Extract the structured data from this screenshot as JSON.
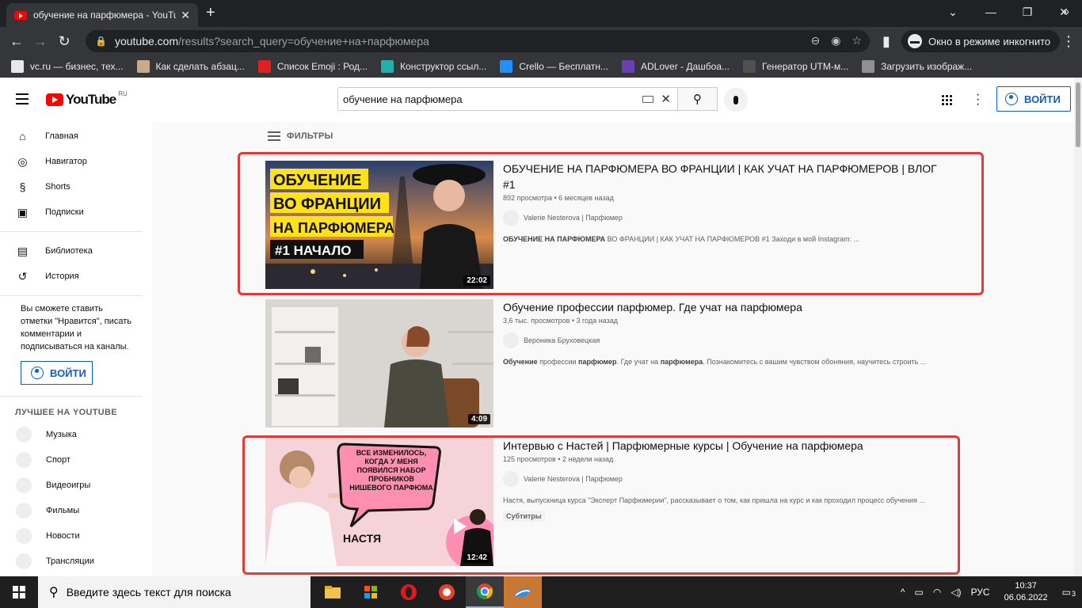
{
  "browser": {
    "tab_title": "обучение на парфюмера - YouTube",
    "url_host": "youtube.com",
    "url_path": "/results?search_query=обучение+на+парфюмера",
    "incognito_label": "Окно в режиме инкогнито",
    "bookmarks": [
      {
        "label": "vc.ru — бизнес, тех...",
        "color": "#e8e8e8"
      },
      {
        "label": "Как сделать абзац...",
        "color": "#c9a98b"
      },
      {
        "label": "Список Emoji : Род...",
        "color": "#e02020"
      },
      {
        "label": "Конструктор ссыл...",
        "color": "#20b2aa"
      },
      {
        "label": "Crello — Бесплатн...",
        "color": "#1e90ff"
      },
      {
        "label": "ADLover - Дашбоа...",
        "color": "#6a3fb5"
      },
      {
        "label": "Генератор UTM-м...",
        "color": "#505050"
      },
      {
        "label": "Загрузить изображ...",
        "color": "#909090"
      }
    ]
  },
  "youtube": {
    "logo_text": "YouTube",
    "logo_region": "RU",
    "search_value": "обучение на парфюмера",
    "signin_label": "ВОЙТИ",
    "filters_label": "ФИЛЬТРЫ",
    "sidebar": {
      "main": [
        {
          "label": "Главная",
          "icon": "home-icon",
          "glyph": "⌂"
        },
        {
          "label": "Навигатор",
          "icon": "compass-icon",
          "glyph": "◎"
        },
        {
          "label": "Shorts",
          "icon": "shorts-icon",
          "glyph": "§"
        },
        {
          "label": "Подписки",
          "icon": "subscriptions-icon",
          "glyph": "▣"
        }
      ],
      "library": [
        {
          "label": "Библиотека",
          "icon": "library-icon",
          "glyph": "▤"
        },
        {
          "label": "История",
          "icon": "history-icon",
          "glyph": "↺"
        }
      ],
      "signin_prompt": "Вы сможете ставить отметки \"Нравится\", писать комментарии и подписываться на каналы.",
      "signin_label": "ВОЙТИ",
      "best_header": "ЛУЧШЕЕ НА YOUTUBE",
      "best": [
        "Музыка",
        "Спорт",
        "Видеоигры",
        "Фильмы",
        "Новости",
        "Трансляции"
      ]
    },
    "results": [
      {
        "title": "ОБУЧЕНИЕ НА ПАРФЮМЕРА ВО ФРАНЦИИ | КАК УЧАТ НА ПАРФЮМЕРОВ | ВЛОГ #1",
        "meta": "892 просмотра • 6 месяцев назад",
        "channel": "Valerie Nesterova | Парфюмер",
        "desc_bold": "ОБУЧЕНИЕ НА ПАРФЮМЕРА",
        "desc_rest": " ВО ФРАНЦИИ | КАК УЧАТ НА ПАРФЮМЕРОВ #1 Заходи в мой Instagram: ...",
        "duration": "22:02",
        "thumb_lines": [
          "ОБУЧЕНИЕ",
          "ВО ФРАНЦИИ",
          "НА ПАРФЮМЕРА",
          "#1 НАЧАЛО"
        ]
      },
      {
        "title": "Обучение профессии парфюмер. Где учат на парфюмера",
        "meta": "3,6 тыс. просмотров • 3 года назад",
        "channel": "Вероника Бруховецкая",
        "desc_html_parts": [
          "Обучение",
          " профессии ",
          "парфюмер",
          ". Где учат на ",
          "парфюмера",
          ". Познакомитесь с вашим чувством обоняния, научитесь строить ..."
        ],
        "duration": "4:09"
      },
      {
        "title": "Интервью с Настей | Парфюмерные курсы | Обучение на парфюмера",
        "meta": "125 просмотров • 2 недели назад",
        "channel": "Valerie Nesterova | Парфюмер",
        "desc": "Настя, выпускница курса \"Эксперт Парфюмерии\", рассказывает о том, как пришла на курс и как проходил процесс обучения ...",
        "badge": "Субтитры",
        "duration": "12:42",
        "thumb_bubble": "ВСЕ ИЗМЕНИЛОСЬ, КОГДА У МЕНЯ ПОЯВИЛСЯ НАБОР ПРОБНИКОВ НИШЕВОГО ПАРФЮМА",
        "thumb_name": "НАСТЯ"
      }
    ]
  },
  "taskbar": {
    "search_placeholder": "Введите здесь текст для поиска",
    "lang": "РУС",
    "time": "10:37",
    "date": "06.06.2022",
    "notifications": "3"
  },
  "colors": {
    "highlight": "#e53935",
    "link": "#065fd4",
    "youtube_red": "#ff0000"
  }
}
